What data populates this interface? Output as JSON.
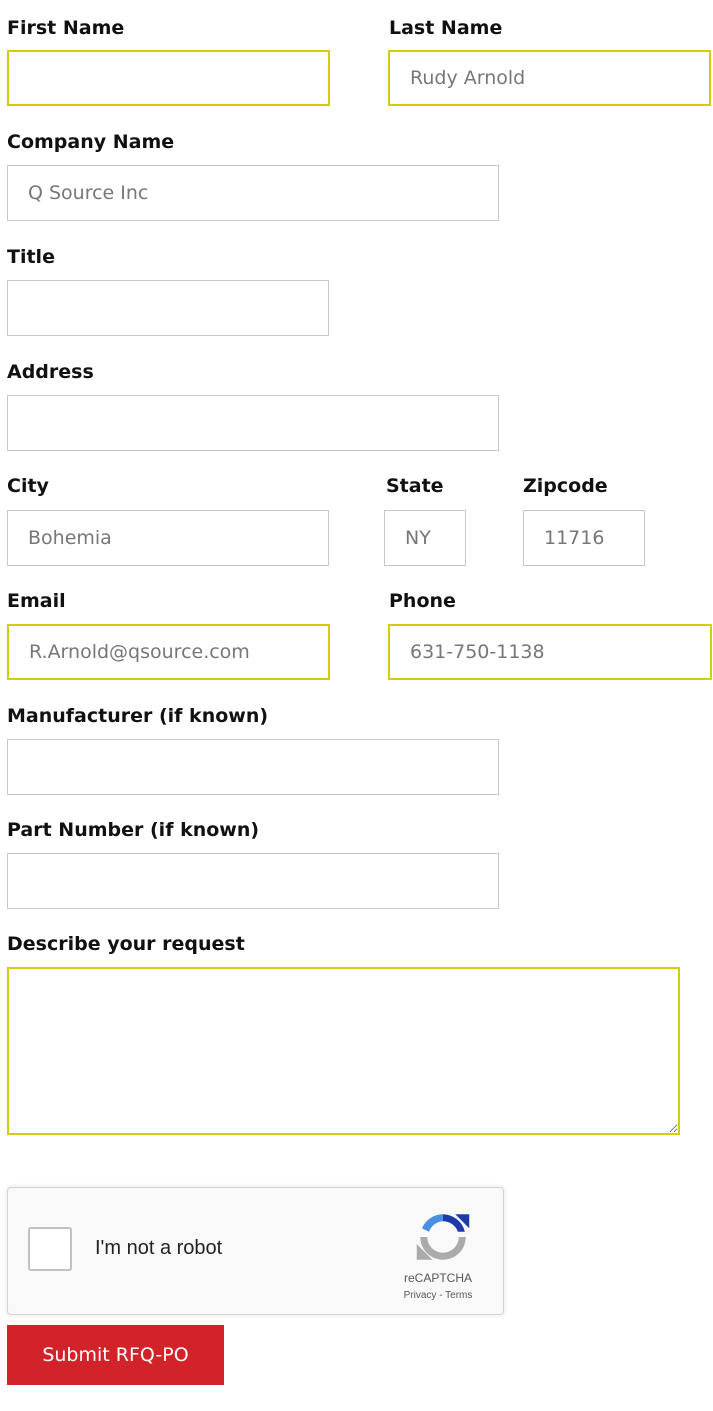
{
  "colors": {
    "highlight_border": "#d4cc10",
    "default_border": "#c8c8c8",
    "submit_bg": "#d2232a",
    "submit_text": "#ffffff"
  },
  "fields": {
    "first_name": {
      "label": "First Name",
      "value": ""
    },
    "last_name": {
      "label": "Last Name",
      "value": "Rudy Arnold"
    },
    "company_name": {
      "label": "Company Name",
      "value": "Q Source Inc"
    },
    "title": {
      "label": "Title",
      "value": ""
    },
    "address": {
      "label": "Address",
      "value": ""
    },
    "city": {
      "label": "City",
      "value": "Bohemia"
    },
    "state": {
      "label": "State",
      "value": "NY"
    },
    "zipcode": {
      "label": "Zipcode",
      "value": "11716"
    },
    "email": {
      "label": "Email",
      "value": "R.Arnold@qsource.com"
    },
    "phone": {
      "label": "Phone",
      "value": "631-750-1138"
    },
    "manufacturer": {
      "label": "Manufacturer (if known)",
      "value": ""
    },
    "part_number": {
      "label": "Part Number (if known)",
      "value": ""
    },
    "request": {
      "label": "Describe your request",
      "value": ""
    }
  },
  "captcha": {
    "checkbox_label": "I'm not a robot",
    "brand": "reCAPTCHA",
    "privacy": "Privacy",
    "separator": " - ",
    "terms": "Terms",
    "icon": "recaptcha-logo-icon"
  },
  "submit_label": "Submit RFQ-PO"
}
